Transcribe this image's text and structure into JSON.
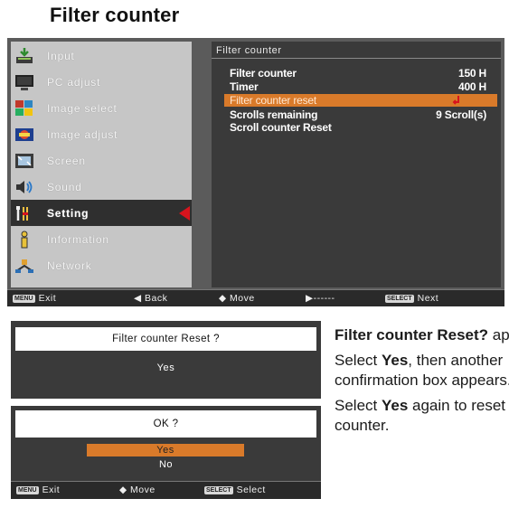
{
  "page": {
    "title": "Filter counter"
  },
  "menu": {
    "items": [
      {
        "label": "Input",
        "icon": "input-icon"
      },
      {
        "label": "PC adjust",
        "icon": "monitor-icon"
      },
      {
        "label": "Image select",
        "icon": "image-select-icon"
      },
      {
        "label": "Image adjust",
        "icon": "image-adjust-icon"
      },
      {
        "label": "Screen",
        "icon": "screen-icon"
      },
      {
        "label": "Sound",
        "icon": "speaker-icon"
      },
      {
        "label": "Setting",
        "icon": "wrench-icon",
        "active": true
      },
      {
        "label": "Information",
        "icon": "info-icon"
      },
      {
        "label": "Network",
        "icon": "network-icon"
      }
    ]
  },
  "panel": {
    "title": "Filter counter",
    "rows": [
      {
        "label": "Filter counter",
        "value": "150 H"
      },
      {
        "label": "Timer",
        "value": "400 H"
      },
      {
        "label": "Filter counter reset",
        "value": "",
        "highlight": true
      },
      {
        "label": "Scrolls remaining",
        "value": "9 Scroll(s)"
      },
      {
        "label": "Scroll counter Reset",
        "value": ""
      }
    ]
  },
  "status": {
    "menu_key": "MENU",
    "exit": "Exit",
    "back": "◀ Back",
    "move": "◆ Move",
    "next_dash": "▶------",
    "select_key": "SELECT",
    "next": "Next"
  },
  "dialog1": {
    "prompt": "Filter counter  Reset ?",
    "yes": "Yes"
  },
  "dialog2": {
    "prompt": "OK ?",
    "yes": "Yes",
    "no": "No",
    "status": {
      "menu_key": "MENU",
      "exit": "Exit",
      "move": "◆ Move",
      "select_key": "SELECT",
      "select": "Select"
    }
  },
  "description": {
    "p1_bold": "Filter counter Reset?",
    "p1_rest": " appears.",
    "p2_a": "Select ",
    "p2_bold": "Yes",
    "p2_b": ", then another confirmation box appears.",
    "p3_a": "Select ",
    "p3_bold": "Yes",
    "p3_b": " again to reset the Filter counter."
  },
  "colors": {
    "highlight": "#d97a2a",
    "arrow": "#d8141d",
    "osd_dark": "#3a3a3a",
    "menu_gray": "#c6c6c6"
  }
}
